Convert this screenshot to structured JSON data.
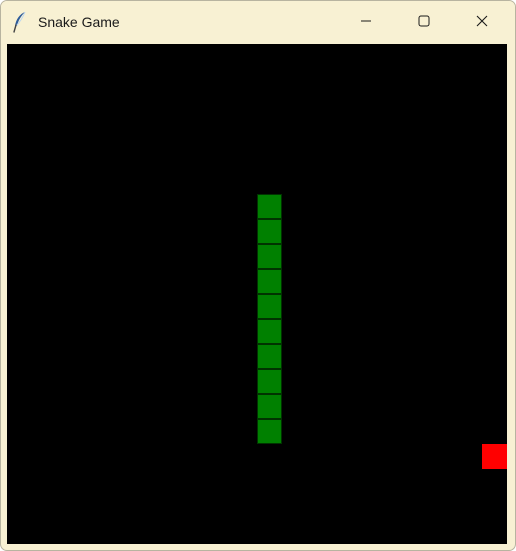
{
  "window": {
    "title": "Snake Game",
    "icon": "feather-icon",
    "buttons": [
      "minimize-icon",
      "maximize-icon",
      "close-icon"
    ]
  },
  "game": {
    "background_color": "#000000",
    "grid_columns": 20,
    "grid_rows": 20,
    "snake_color": "#008000",
    "food_color": "#ff0000",
    "snake": [
      [
        10,
        6
      ],
      [
        10,
        7
      ],
      [
        10,
        8
      ],
      [
        10,
        9
      ],
      [
        10,
        10
      ],
      [
        10,
        11
      ],
      [
        10,
        12
      ],
      [
        10,
        13
      ],
      [
        10,
        14
      ],
      [
        10,
        15
      ]
    ],
    "food": [
      19,
      16
    ]
  }
}
